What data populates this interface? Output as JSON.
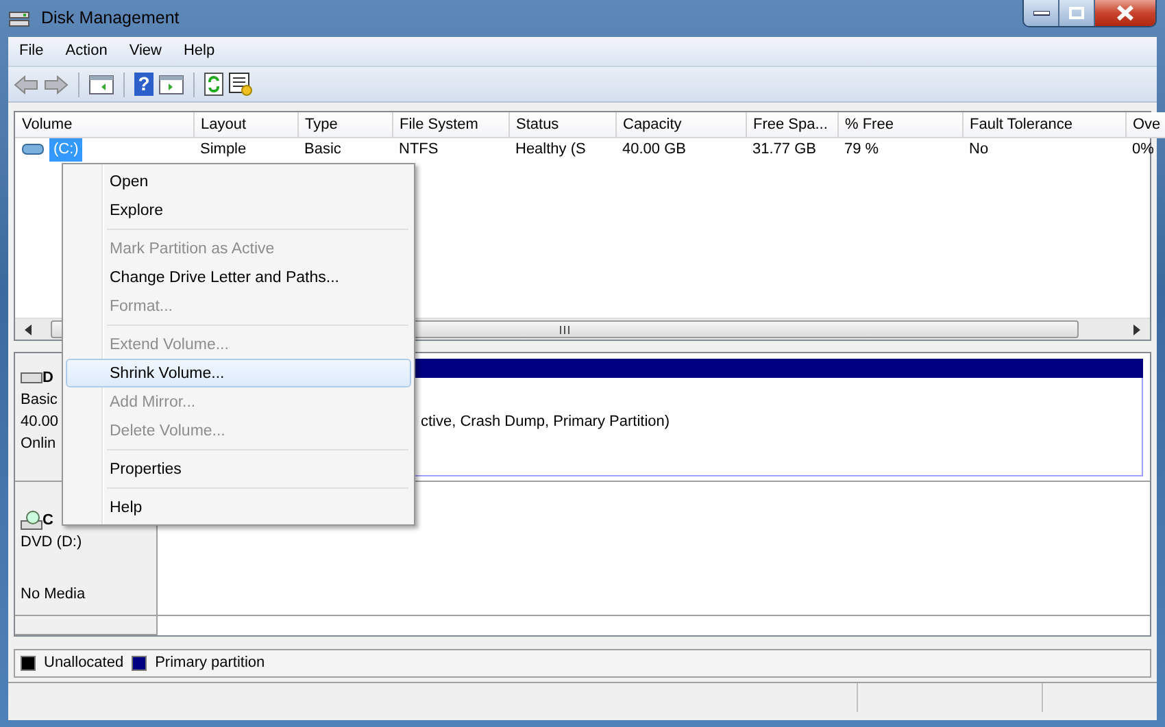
{
  "window": {
    "title": "Disk Management"
  },
  "menu_bar": [
    "File",
    "Action",
    "View",
    "Help"
  ],
  "toolbar": {
    "help_glyph": "?"
  },
  "volume_table": {
    "columns": [
      "Volume",
      "Layout",
      "Type",
      "File System",
      "Status",
      "Capacity",
      "Free Spa...",
      "% Free",
      "Fault Tolerance",
      "Ove"
    ],
    "rows": [
      {
        "selected": true,
        "cells": [
          "(C:)",
          "Simple",
          "Basic",
          "NTFS",
          "Healthy (S",
          "40.00 GB",
          "31.77 GB",
          "79 %",
          "No",
          "0%"
        ]
      }
    ]
  },
  "disks": [
    {
      "kind": "disk",
      "label": "D",
      "type": "Basic",
      "size": "40.00",
      "status": "Onlin",
      "partition": {
        "color": "#000080",
        "text": "ctive, Crash Dump, Primary Partition)"
      }
    },
    {
      "kind": "cdrom",
      "label": "C",
      "type": "DVD (D:)",
      "status": "No Media"
    }
  ],
  "legend": [
    {
      "label": "Unallocated",
      "color": "#000000"
    },
    {
      "label": "Primary partition",
      "color": "#000080"
    }
  ],
  "context_menu": [
    {
      "kind": "item",
      "label": "Open",
      "disabled": false,
      "selected": false
    },
    {
      "kind": "item",
      "label": "Explore",
      "disabled": false,
      "selected": false
    },
    {
      "kind": "separator"
    },
    {
      "kind": "item",
      "label": "Mark Partition as Active",
      "disabled": true,
      "selected": false
    },
    {
      "kind": "item",
      "label": "Change Drive Letter and Paths...",
      "disabled": false,
      "selected": false
    },
    {
      "kind": "item",
      "label": "Format...",
      "disabled": true,
      "selected": false
    },
    {
      "kind": "separator"
    },
    {
      "kind": "item",
      "label": "Extend Volume...",
      "disabled": true,
      "selected": false
    },
    {
      "kind": "item",
      "label": "Shrink Volume...",
      "disabled": false,
      "selected": true
    },
    {
      "kind": "item",
      "label": "Add Mirror...",
      "disabled": true,
      "selected": false
    },
    {
      "kind": "item",
      "label": "Delete Volume...",
      "disabled": true,
      "selected": false
    },
    {
      "kind": "separator"
    },
    {
      "kind": "item",
      "label": "Properties",
      "disabled": false,
      "selected": false
    },
    {
      "kind": "separator"
    },
    {
      "kind": "item",
      "label": "Help",
      "disabled": false,
      "selected": false
    }
  ]
}
